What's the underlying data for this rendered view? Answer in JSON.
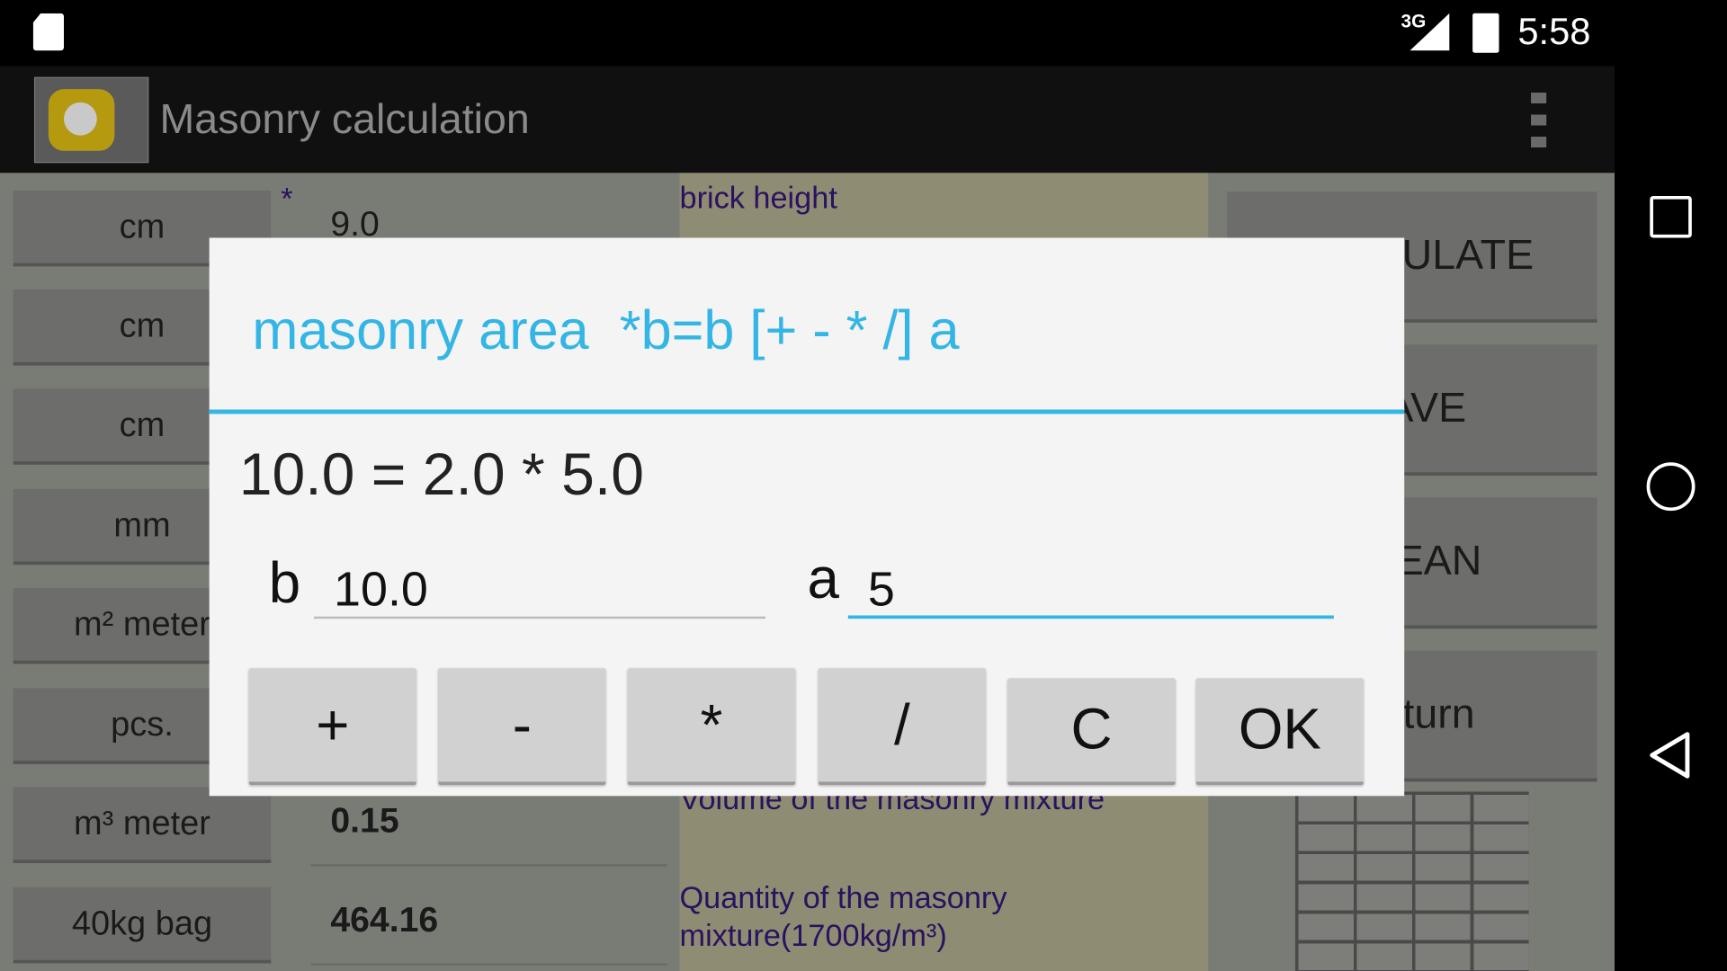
{
  "status_bar": {
    "network": "3G",
    "time": "5:58"
  },
  "app_bar": {
    "title": "Masonry calculation"
  },
  "background_form": {
    "unit_buttons": [
      "cm",
      "cm",
      "cm",
      "mm",
      "m² meter",
      "pcs.",
      "m³ meter",
      "40kg bag"
    ],
    "required_marker": "*",
    "values": {
      "first": "9.0",
      "volume": "0.15",
      "quantity": "464.16"
    },
    "descriptions": {
      "first": "brick height",
      "volume": "Volume of the masonry mixture",
      "quantity": "Quantity of the masonry mixture(1700kg/m³)"
    },
    "action_buttons": [
      "CALCULATE",
      "SAVE",
      "CLEAN",
      "Return"
    ]
  },
  "dialog": {
    "title": "masonry area  *b=b [+ - * /] a",
    "expression": "10.0 = 2.0 * 5.0",
    "b_label": "b",
    "b_value": "10.0",
    "a_label": "a",
    "a_value": "5",
    "buttons": {
      "plus": "+",
      "minus": "-",
      "multiply": "*",
      "divide": "/",
      "clear": "C",
      "ok": "OK"
    }
  },
  "colors": {
    "accent": "#33b5e5",
    "description_text": "#2a1260",
    "dialog_bg": "#f4f4f4"
  }
}
